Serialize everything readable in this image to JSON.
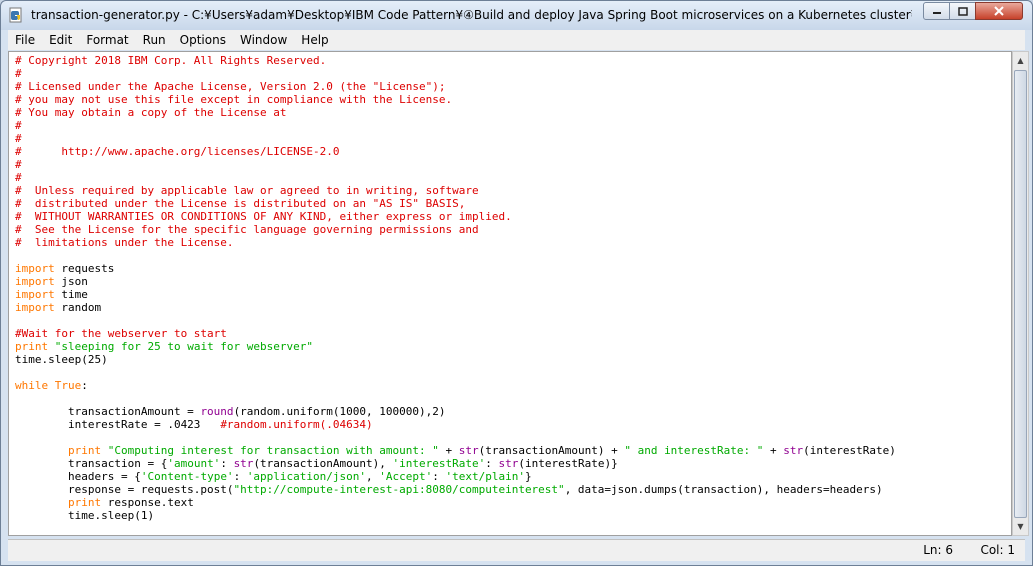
{
  "window": {
    "title": "transaction-generator.py - C:¥Users¥adam¥Desktop¥IBM Code Pattern¥④Build and deploy Java Spring Boot microservices on a Kubernetes cluster¥s..."
  },
  "menu": [
    "File",
    "Edit",
    "Format",
    "Run",
    "Options",
    "Window",
    "Help"
  ],
  "editor": {
    "lines": [
      [
        {
          "t": "# Copyright 2018 IBM Corp. All Rights Reserved.",
          "c": "com"
        }
      ],
      [
        {
          "t": "#",
          "c": "com"
        }
      ],
      [
        {
          "t": "# Licensed under the Apache License, Version 2.0 (the \"License\");",
          "c": "com"
        }
      ],
      [
        {
          "t": "# you may not use this file except in compliance with the License.",
          "c": "com"
        }
      ],
      [
        {
          "t": "# You may obtain a copy of the License at",
          "c": "com"
        }
      ],
      [
        {
          "t": "#",
          "c": "com"
        }
      ],
      [
        {
          "t": "#",
          "c": "com"
        }
      ],
      [
        {
          "t": "#      http://www.apache.org/licenses/LICENSE-2.0",
          "c": "com"
        }
      ],
      [
        {
          "t": "#",
          "c": "com"
        }
      ],
      [
        {
          "t": "#",
          "c": "com"
        }
      ],
      [
        {
          "t": "#  Unless required by applicable law or agreed to in writing, software",
          "c": "com"
        }
      ],
      [
        {
          "t": "#  distributed under the License is distributed on an \"AS IS\" BASIS,",
          "c": "com"
        }
      ],
      [
        {
          "t": "#  WITHOUT WARRANTIES OR CONDITIONS OF ANY KIND, either express or implied.",
          "c": "com"
        }
      ],
      [
        {
          "t": "#  See the License for the specific language governing permissions and",
          "c": "com"
        }
      ],
      [
        {
          "t": "#  limitations under the License.",
          "c": "com"
        }
      ],
      [],
      [
        {
          "t": "import",
          "c": "kw"
        },
        {
          "t": " requests"
        }
      ],
      [
        {
          "t": "import",
          "c": "kw"
        },
        {
          "t": " json"
        }
      ],
      [
        {
          "t": "import",
          "c": "kw"
        },
        {
          "t": " time"
        }
      ],
      [
        {
          "t": "import",
          "c": "kw"
        },
        {
          "t": " random"
        }
      ],
      [],
      [
        {
          "t": "#Wait for the webserver to start",
          "c": "com"
        }
      ],
      [
        {
          "t": "print",
          "c": "kw"
        },
        {
          "t": " \"sleeping for 25 to wait for webserver\"",
          "c": "str"
        }
      ],
      [
        {
          "t": "time.sleep(25)"
        }
      ],
      [],
      [
        {
          "t": "while",
          "c": "kw"
        },
        {
          "t": " "
        },
        {
          "t": "True",
          "c": "kw"
        },
        {
          "t": ":"
        }
      ],
      [],
      [
        {
          "t": "        transactionAmount = "
        },
        {
          "t": "round",
          "c": "bi"
        },
        {
          "t": "(random.uniform(1000, 100000),2)"
        }
      ],
      [
        {
          "t": "        interestRate = .0423   "
        },
        {
          "t": "#random.uniform(.04634)",
          "c": "com"
        }
      ],
      [],
      [
        {
          "t": "        "
        },
        {
          "t": "print",
          "c": "kw"
        },
        {
          "t": " \"Computing interest for transaction with amount: \"",
          "c": "str"
        },
        {
          "t": " + "
        },
        {
          "t": "str",
          "c": "bi"
        },
        {
          "t": "(transactionAmount) + "
        },
        {
          "t": "\" and interestRate: \"",
          "c": "str"
        },
        {
          "t": " + "
        },
        {
          "t": "str",
          "c": "bi"
        },
        {
          "t": "(interestRate)"
        }
      ],
      [
        {
          "t": "        transaction = {"
        },
        {
          "t": "'amount'",
          "c": "str"
        },
        {
          "t": ": "
        },
        {
          "t": "str",
          "c": "bi"
        },
        {
          "t": "(transactionAmount), "
        },
        {
          "t": "'interestRate'",
          "c": "str"
        },
        {
          "t": ": "
        },
        {
          "t": "str",
          "c": "bi"
        },
        {
          "t": "(interestRate)}"
        }
      ],
      [
        {
          "t": "        headers = {"
        },
        {
          "t": "'Content-type'",
          "c": "str"
        },
        {
          "t": ": "
        },
        {
          "t": "'application/json'",
          "c": "str"
        },
        {
          "t": ", "
        },
        {
          "t": "'Accept'",
          "c": "str"
        },
        {
          "t": ": "
        },
        {
          "t": "'text/plain'",
          "c": "str"
        },
        {
          "t": "}"
        }
      ],
      [
        {
          "t": "        response = requests.post("
        },
        {
          "t": "\"http://compute-interest-api:8080/computeinterest\"",
          "c": "str"
        },
        {
          "t": ", data=json.dumps(transaction), headers=headers)"
        }
      ],
      [
        {
          "t": "        "
        },
        {
          "t": "print",
          "c": "kw"
        },
        {
          "t": " response.text"
        }
      ],
      [
        {
          "t": "        time.sleep(1)"
        }
      ]
    ]
  },
  "status": {
    "line": "Ln: 6",
    "col": "Col: 1"
  },
  "colors": {
    "comment": "#dd0000",
    "keyword": "#ff7700",
    "string": "#00aa00",
    "builtin": "#900090"
  }
}
